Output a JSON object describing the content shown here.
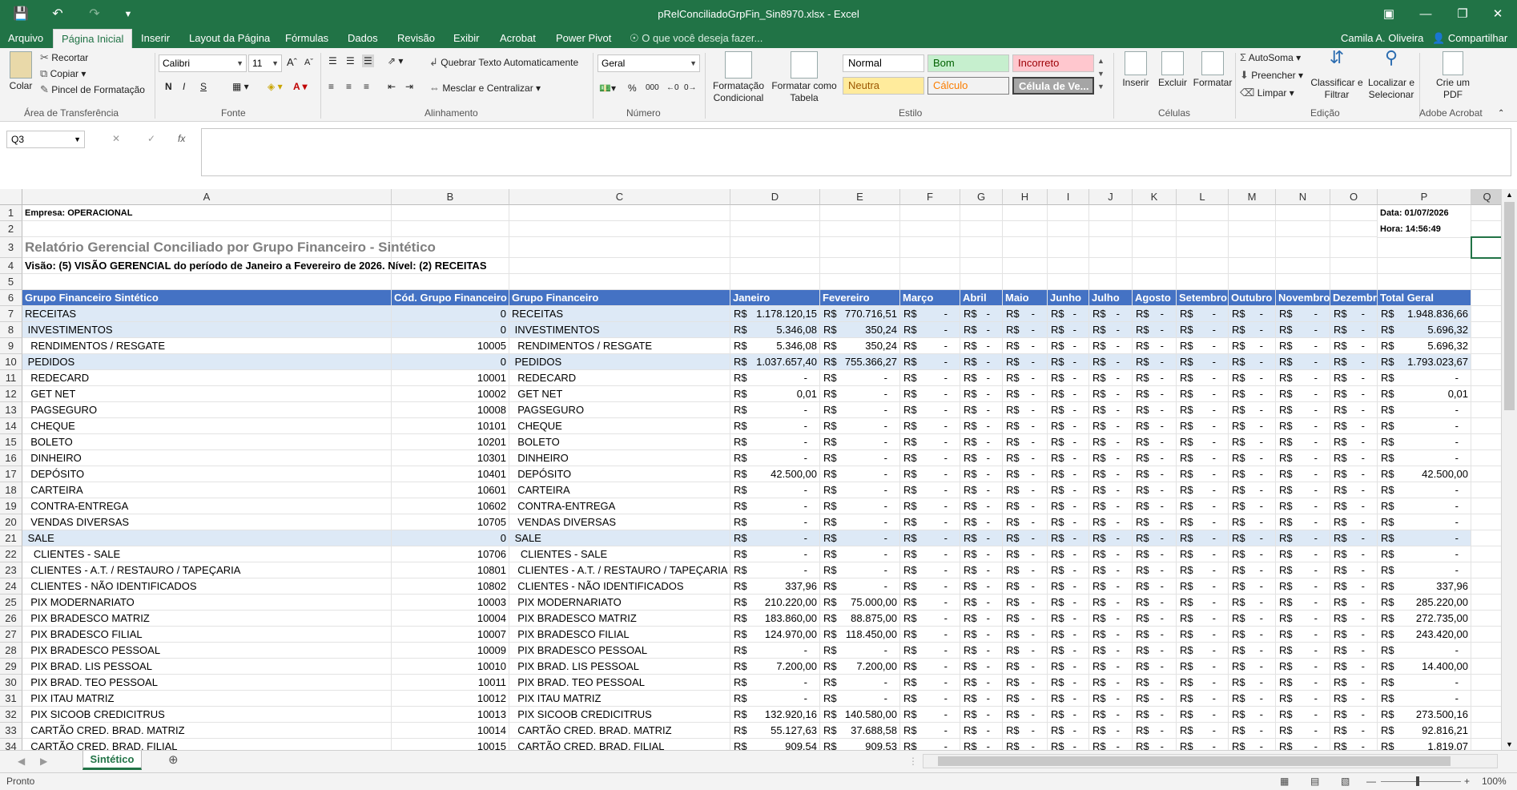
{
  "window": {
    "title": "pRelConciliadoGrpFin_Sin8970.xlsx - Excel",
    "user": "Camila A. Oliveira",
    "share": "Compartilhar"
  },
  "tabs": [
    "Arquivo",
    "Página Inicial",
    "Inserir",
    "Layout da Página",
    "Fórmulas",
    "Dados",
    "Revisão",
    "Exibir",
    "Acrobat",
    "Power Pivot"
  ],
  "tell_me": "O que você deseja fazer...",
  "ribbon": {
    "clipboard": {
      "paste": "Colar",
      "cut": "Recortar",
      "copy": "Copiar",
      "painter": "Pincel de Formatação",
      "label": "Área de Transferência"
    },
    "font": {
      "name": "Calibri",
      "size": "11",
      "bold": "N",
      "italic": "I",
      "underline": "S",
      "label": "Fonte"
    },
    "alignment": {
      "wrap": "Quebrar Texto Automaticamente",
      "merge": "Mesclar e Centralizar",
      "label": "Alinhamento"
    },
    "number": {
      "format": "Geral",
      "label": "Número"
    },
    "styles": {
      "cond": "Formatação Condicional",
      "table": "Formatar como Tabela",
      "normal": "Normal",
      "good": "Bom",
      "bad": "Incorreto",
      "neutral": "Neutra",
      "calc": "Cálculo",
      "check": "Célula de Ve...",
      "label": "Estilo"
    },
    "cells": {
      "insert": "Inserir",
      "delete": "Excluir",
      "format": "Formatar",
      "label": "Células"
    },
    "editing": {
      "autosum": "AutoSoma",
      "fill": "Preencher",
      "clear": "Limpar",
      "sort": "Classificar e Filtrar",
      "find": "Localizar e Selecionar",
      "label": "Edição"
    },
    "acrobat": {
      "create": "Crie um PDF",
      "label": "Adobe Acrobat"
    }
  },
  "namebox": "Q3",
  "columns": [
    "A",
    "B",
    "C",
    "D",
    "E",
    "F",
    "G",
    "H",
    "I",
    "J",
    "K",
    "L",
    "M",
    "N",
    "O",
    "P",
    "Q"
  ],
  "meta": {
    "company": "Empresa: OPERACIONAL",
    "date": "Data: 01/07/2026",
    "time": "Hora: 14:56:49",
    "report_title": "Relatório Gerencial Conciliado por Grupo Financeiro - Sintético",
    "vision": "Visão: (5) VISÃO GERENCIAL do período de Janeiro a Fevereiro de 2026. Nível: (2) RECEITAS"
  },
  "headers": [
    "Grupo Financeiro Sintético",
    "Cód. Grupo Financeiro",
    "Grupo Financeiro",
    "Janeiro",
    "Fevereiro",
    "Março",
    "Abril",
    "Maio",
    "Junho",
    "Julho",
    "Agosto",
    "Setembro",
    "Outubro",
    "Novembro",
    "Dezembro",
    "Total Geral"
  ],
  "currency": "R$",
  "rows": [
    {
      "n": "7",
      "a": "RECEITAS",
      "b": "0",
      "c": "RECEITAS",
      "jan": "1.178.120,15",
      "fev": "770.716,51",
      "tot": "1.948.836,66",
      "band": true
    },
    {
      "n": "8",
      "a": " INVESTIMENTOS",
      "b": "0",
      "c": " INVESTIMENTOS",
      "jan": "5.346,08",
      "fev": "350,24",
      "tot": "5.696,32",
      "band": true
    },
    {
      "n": "9",
      "a": "  RENDIMENTOS / RESGATE",
      "b": "10005",
      "c": "  RENDIMENTOS / RESGATE",
      "jan": "5.346,08",
      "fev": "350,24",
      "tot": "5.696,32",
      "band": false
    },
    {
      "n": "10",
      "a": " PEDIDOS",
      "b": "0",
      "c": " PEDIDOS",
      "jan": "1.037.657,40",
      "fev": "755.366,27",
      "tot": "1.793.023,67",
      "band": true
    },
    {
      "n": "11",
      "a": "  REDECARD",
      "b": "10001",
      "c": "  REDECARD",
      "jan": "-",
      "fev": "-",
      "tot": "-",
      "band": false
    },
    {
      "n": "12",
      "a": "  GET NET",
      "b": "10002",
      "c": "  GET NET",
      "jan": "0,01",
      "fev": "-",
      "tot": "0,01",
      "band": false
    },
    {
      "n": "13",
      "a": "  PAGSEGURO",
      "b": "10008",
      "c": "  PAGSEGURO",
      "jan": "-",
      "fev": "-",
      "tot": "-",
      "band": false
    },
    {
      "n": "14",
      "a": "  CHEQUE",
      "b": "10101",
      "c": "  CHEQUE",
      "jan": "-",
      "fev": "-",
      "tot": "-",
      "band": false
    },
    {
      "n": "15",
      "a": "  BOLETO",
      "b": "10201",
      "c": "  BOLETO",
      "jan": "-",
      "fev": "-",
      "tot": "-",
      "band": false
    },
    {
      "n": "16",
      "a": "  DINHEIRO",
      "b": "10301",
      "c": "  DINHEIRO",
      "jan": "-",
      "fev": "-",
      "tot": "-",
      "band": false
    },
    {
      "n": "17",
      "a": "  DEPÓSITO",
      "b": "10401",
      "c": "  DEPÓSITO",
      "jan": "42.500,00",
      "fev": "-",
      "tot": "42.500,00",
      "band": false
    },
    {
      "n": "18",
      "a": "  CARTEIRA",
      "b": "10601",
      "c": "  CARTEIRA",
      "jan": "-",
      "fev": "-",
      "tot": "-",
      "band": false
    },
    {
      "n": "19",
      "a": "  CONTRA-ENTREGA",
      "b": "10602",
      "c": "  CONTRA-ENTREGA",
      "jan": "-",
      "fev": "-",
      "tot": "-",
      "band": false
    },
    {
      "n": "20",
      "a": "  VENDAS DIVERSAS",
      "b": "10705",
      "c": "  VENDAS DIVERSAS",
      "jan": "-",
      "fev": "-",
      "tot": "-",
      "band": false
    },
    {
      "n": "21",
      "a": " SALE",
      "b": "0",
      "c": " SALE",
      "jan": "-",
      "fev": "-",
      "tot": "-",
      "band": true
    },
    {
      "n": "22",
      "a": "   CLIENTES - SALE",
      "b": "10706",
      "c": "   CLIENTES - SALE",
      "jan": "-",
      "fev": "-",
      "tot": "-",
      "band": false
    },
    {
      "n": "23",
      "a": "  CLIENTES - A.T. / RESTAURO / TAPEÇARIA",
      "b": "10801",
      "c": "  CLIENTES - A.T. / RESTAURO / TAPEÇARIA",
      "jan": "-",
      "fev": "-",
      "tot": "-",
      "band": false
    },
    {
      "n": "24",
      "a": "  CLIENTES - NÃO IDENTIFICADOS",
      "b": "10802",
      "c": "  CLIENTES - NÃO IDENTIFICADOS",
      "jan": "337,96",
      "fev": "-",
      "tot": "337,96",
      "band": false
    },
    {
      "n": "25",
      "a": "  PIX MODERNARIATO",
      "b": "10003",
      "c": "  PIX MODERNARIATO",
      "jan": "210.220,00",
      "fev": "75.000,00",
      "tot": "285.220,00",
      "band": false
    },
    {
      "n": "26",
      "a": "  PIX BRADESCO MATRIZ",
      "b": "10004",
      "c": "  PIX BRADESCO MATRIZ",
      "jan": "183.860,00",
      "fev": "88.875,00",
      "tot": "272.735,00",
      "band": false
    },
    {
      "n": "27",
      "a": "  PIX BRADESCO FILIAL",
      "b": "10007",
      "c": "  PIX BRADESCO FILIAL",
      "jan": "124.970,00",
      "fev": "118.450,00",
      "tot": "243.420,00",
      "band": false
    },
    {
      "n": "28",
      "a": "  PIX BRADESCO PESSOAL",
      "b": "10009",
      "c": "  PIX BRADESCO PESSOAL",
      "jan": "-",
      "fev": "-",
      "tot": "-",
      "band": false
    },
    {
      "n": "29",
      "a": "  PIX BRAD. LIS PESSOAL",
      "b": "10010",
      "c": "  PIX BRAD. LIS PESSOAL",
      "jan": "7.200,00",
      "fev": "7.200,00",
      "tot": "14.400,00",
      "band": false
    },
    {
      "n": "30",
      "a": "  PIX BRAD. TEO PESSOAL",
      "b": "10011",
      "c": "  PIX BRAD. TEO PESSOAL",
      "jan": "-",
      "fev": "-",
      "tot": "-",
      "band": false
    },
    {
      "n": "31",
      "a": "  PIX ITAU MATRIZ",
      "b": "10012",
      "c": "  PIX ITAU MATRIZ",
      "jan": "-",
      "fev": "-",
      "tot": "-",
      "band": false
    },
    {
      "n": "32",
      "a": "  PIX SICOOB CREDICITRUS",
      "b": "10013",
      "c": "  PIX SICOOB CREDICITRUS",
      "jan": "132.920,16",
      "fev": "140.580,00",
      "tot": "273.500,16",
      "band": false
    },
    {
      "n": "33",
      "a": "  CARTÃO CRED. BRAD. MATRIZ",
      "b": "10014",
      "c": "  CARTÃO CRED. BRAD. MATRIZ",
      "jan": "55.127,63",
      "fev": "37.688,58",
      "tot": "92.816,21",
      "band": false
    },
    {
      "n": "34",
      "a": "  CARTÃO CRED. BRAD. FILIAL",
      "b": "10015",
      "c": "  CARTÃO CRED. BRAD. FILIAL",
      "jan": "909,54",
      "fev": "909,53",
      "tot": "1.819,07",
      "band": false
    }
  ],
  "sheet": "Sintético",
  "status": {
    "ready": "Pronto",
    "zoom": "100%"
  }
}
